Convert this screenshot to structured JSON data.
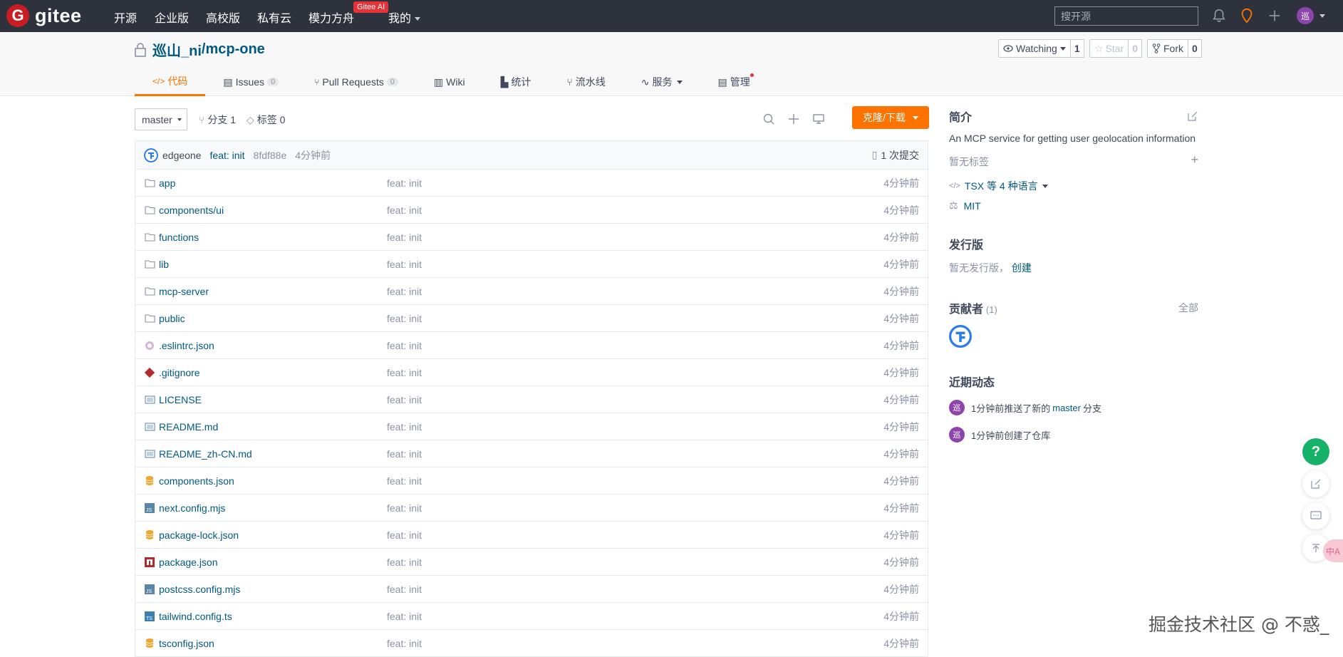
{
  "nav": {
    "logo_text": "gitee",
    "links": [
      "开源",
      "企业版",
      "高校版",
      "私有云",
      "模力方舟",
      "我的"
    ],
    "ai_badge": "Gitee AI",
    "search_placeholder": "搜开源",
    "avatar_text": "巡"
  },
  "repo": {
    "owner": "巡山_ni",
    "name": "mcp-one",
    "watch_label": "Watching",
    "watch_count": "1",
    "star_label": "Star",
    "star_count": "0",
    "fork_label": "Fork",
    "fork_count": "0"
  },
  "tabs": [
    {
      "label": "代码",
      "count": ""
    },
    {
      "label": "Issues",
      "count": "0"
    },
    {
      "label": "Pull Requests",
      "count": "0"
    },
    {
      "label": "Wiki",
      "count": ""
    },
    {
      "label": "统计",
      "count": ""
    },
    {
      "label": "流水线",
      "count": ""
    },
    {
      "label": "服务",
      "count": ""
    },
    {
      "label": "管理",
      "count": ""
    }
  ],
  "toolbar": {
    "branch": "master",
    "branches_label": "分支 1",
    "tags_label": "标签 0",
    "clone_label": "克隆/下载"
  },
  "commit": {
    "author": "edgeone",
    "message": "feat: init",
    "sha": "8fdf88e",
    "time": "4分钟前",
    "count_label": "1 次提交"
  },
  "files": [
    {
      "name": "app",
      "msg": "feat: init",
      "time": "4分钟前",
      "icon": "folder-icon"
    },
    {
      "name": "components/ui",
      "msg": "feat: init",
      "time": "4分钟前",
      "icon": "folder-icon"
    },
    {
      "name": "functions",
      "msg": "feat: init",
      "time": "4分钟前",
      "icon": "folder-icon"
    },
    {
      "name": "lib",
      "msg": "feat: init",
      "time": "4分钟前",
      "icon": "folder-icon"
    },
    {
      "name": "mcp-server",
      "msg": "feat: init",
      "time": "4分钟前",
      "icon": "folder-icon"
    },
    {
      "name": "public",
      "msg": "feat: init",
      "time": "4分钟前",
      "icon": "folder-icon"
    },
    {
      "name": ".eslintrc.json",
      "msg": "feat: init",
      "time": "4分钟前",
      "icon": "eslint-icon"
    },
    {
      "name": ".gitignore",
      "msg": "feat: init",
      "time": "4分钟前",
      "icon": "git-icon"
    },
    {
      "name": "LICENSE",
      "msg": "feat: init",
      "time": "4分钟前",
      "icon": "text-file-icon"
    },
    {
      "name": "README.md",
      "msg": "feat: init",
      "time": "4分钟前",
      "icon": "text-file-icon"
    },
    {
      "name": "README_zh-CN.md",
      "msg": "feat: init",
      "time": "4分钟前",
      "icon": "text-file-icon"
    },
    {
      "name": "components.json",
      "msg": "feat: init",
      "time": "4分钟前",
      "icon": "json-icon"
    },
    {
      "name": "next.config.mjs",
      "msg": "feat: init",
      "time": "4分钟前",
      "icon": "js-icon"
    },
    {
      "name": "package-lock.json",
      "msg": "feat: init",
      "time": "4分钟前",
      "icon": "json-icon"
    },
    {
      "name": "package.json",
      "msg": "feat: init",
      "time": "4分钟前",
      "icon": "npm-icon"
    },
    {
      "name": "postcss.config.mjs",
      "msg": "feat: init",
      "time": "4分钟前",
      "icon": "js-icon"
    },
    {
      "name": "tailwind.config.ts",
      "msg": "feat: init",
      "time": "4分钟前",
      "icon": "ts-icon"
    },
    {
      "name": "tsconfig.json",
      "msg": "feat: init",
      "time": "4分钟前",
      "icon": "json-icon"
    }
  ],
  "sidebar": {
    "intro_title": "简介",
    "description": "An MCP service for getting user geolocation information",
    "no_tags": "暂无标签",
    "language": "TSX 等 4 种语言",
    "license": "MIT",
    "release_title": "发行版",
    "no_release": "暂无发行版，",
    "create_link": "创建",
    "contributors_title": "贡献者",
    "contributors_count": "(1)",
    "all_link": "全部",
    "activity_title": "近期动态",
    "activities": [
      {
        "prefix": "1分钟前推送了新的 ",
        "link": "master",
        "suffix": " 分支"
      },
      {
        "prefix": "1分钟前创建了仓库",
        "link": "",
        "suffix": ""
      }
    ]
  },
  "float": {
    "help": "?",
    "translate": "中A"
  },
  "watermark": "掘金技术社区 @ 不惑_",
  "colors": {
    "accent": "#fe7300",
    "nav_bg": "#2e323d",
    "link": "#005980"
  }
}
